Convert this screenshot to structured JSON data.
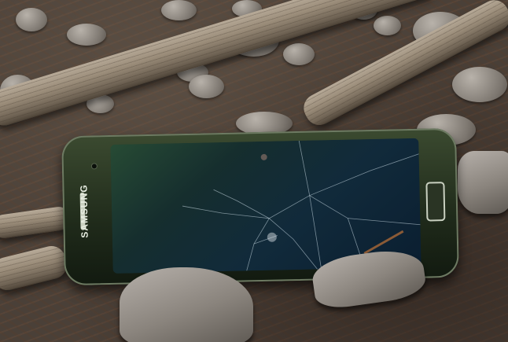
{
  "phone": {
    "brand_label": "SAMSUNG"
  }
}
